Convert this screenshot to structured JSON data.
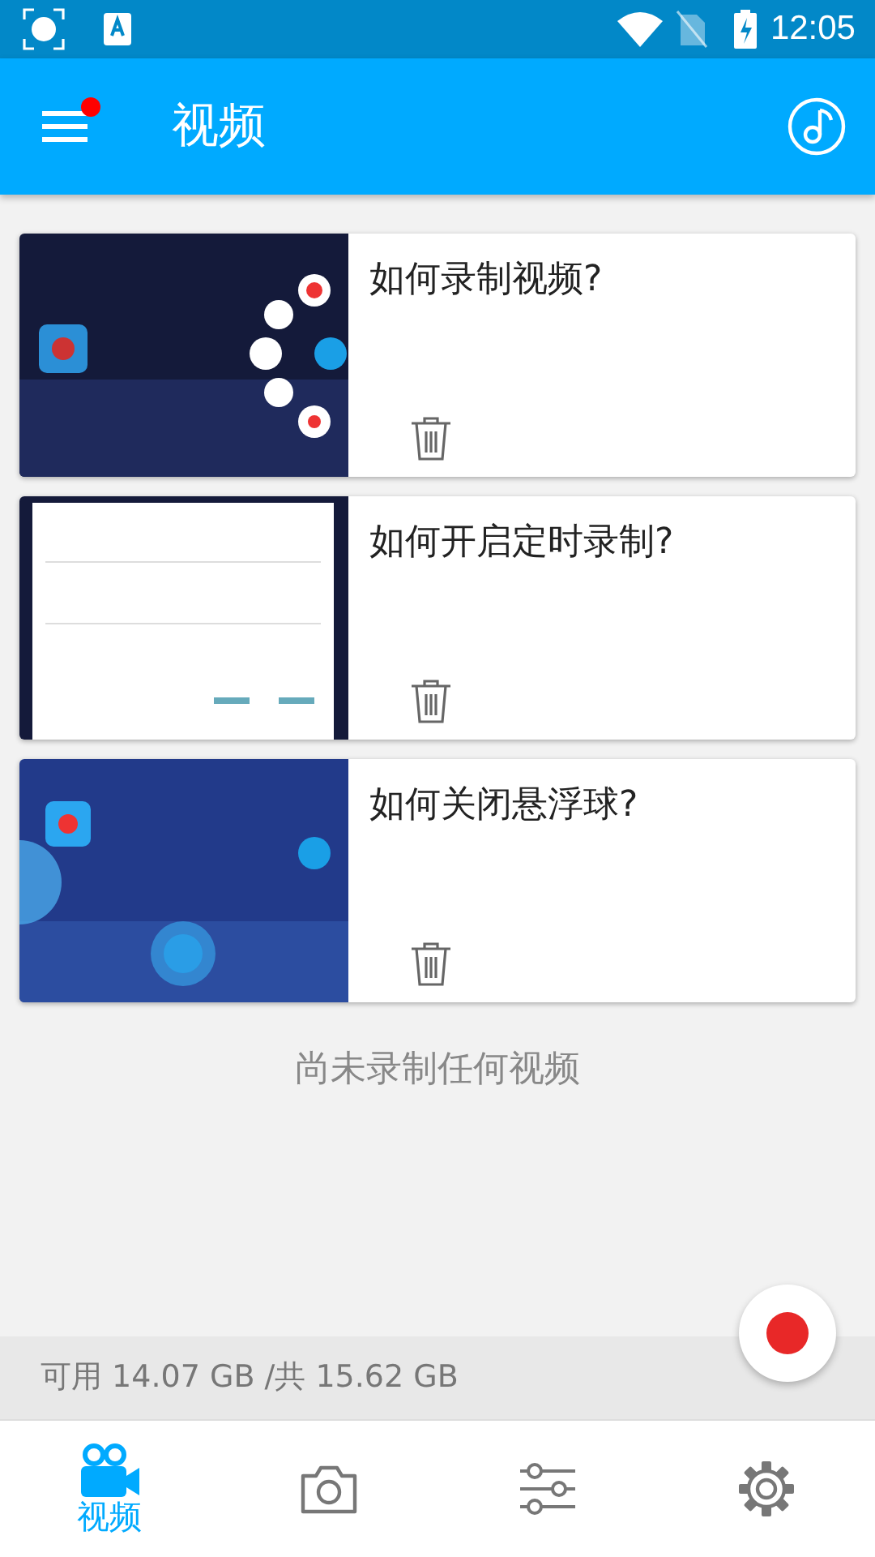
{
  "status_bar": {
    "time": "12:05"
  },
  "app_bar": {
    "title": "视频",
    "menu_badge": true
  },
  "videos": [
    {
      "title": "如何录制视频?"
    },
    {
      "title": "如何开启定时录制?"
    },
    {
      "title": "如何关闭悬浮球?"
    }
  ],
  "empty_message": "尚未录制任何视频",
  "storage": "可用 14.07 GB /共 15.62 GB",
  "bottom_nav": [
    {
      "kind": "video",
      "label": "视频",
      "selected": true
    },
    {
      "kind": "camera",
      "selected": false
    },
    {
      "kind": "tools",
      "selected": false
    },
    {
      "kind": "settings",
      "selected": false
    }
  ]
}
